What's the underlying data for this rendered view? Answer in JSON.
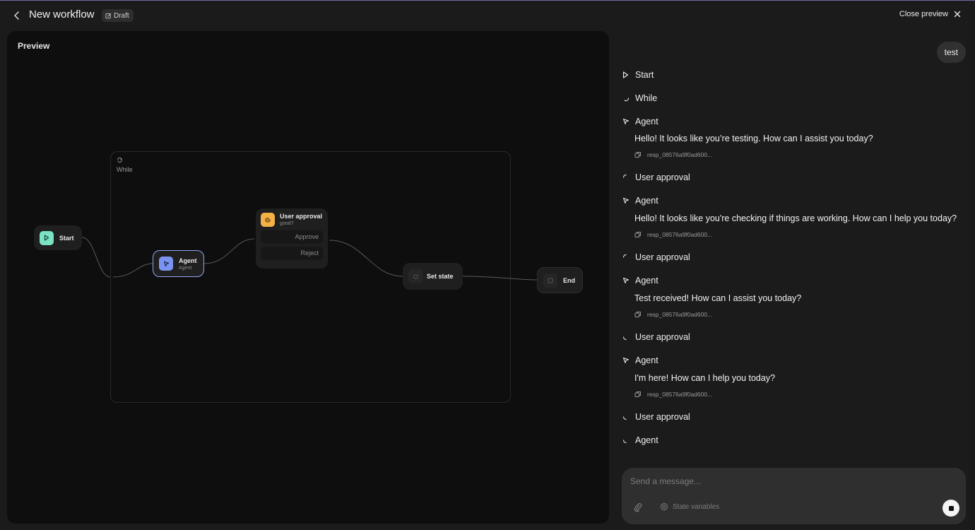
{
  "header": {
    "title": "New workflow",
    "badge": "Draft",
    "close_label": "Close preview"
  },
  "canvas": {
    "title": "Preview",
    "while_label": "While",
    "nodes": {
      "start": {
        "label": "Start"
      },
      "agent": {
        "label": "Agent",
        "sub": "Agent"
      },
      "approval": {
        "label": "User approval",
        "sub": "good?",
        "approve": "Approve",
        "reject": "Reject"
      },
      "setstate": {
        "label": "Set state"
      },
      "end": {
        "label": "End"
      }
    },
    "colors": {
      "start": "#7be3c4",
      "agent": "#7b93f0",
      "approval": "#f3b146",
      "agent_border": "#90a6f5"
    }
  },
  "chat": {
    "user_message": "test",
    "steps": [
      {
        "icon": "play-icon",
        "label": "Start"
      },
      {
        "icon": "spinner-icon",
        "label": "While"
      },
      {
        "icon": "agent-icon",
        "label": "Agent",
        "message": "Hello! It looks like you’re testing. How can I assist you today?",
        "response_id": "resp_08576a9f0ad600..."
      },
      {
        "icon": "spinner-icon",
        "label": "User approval"
      },
      {
        "icon": "agent-icon",
        "label": "Agent",
        "message": "Hello! It looks like you're checking if things are working. How can I help you today?",
        "response_id": "resp_08576a9f0ad600..."
      },
      {
        "icon": "spinner-icon",
        "label": "User approval"
      },
      {
        "icon": "agent-icon",
        "label": "Agent",
        "message": "Test received! How can I assist you today?",
        "response_id": "resp_08576a9f0ad600..."
      },
      {
        "icon": "spinner-icon",
        "label": "User approval"
      },
      {
        "icon": "agent-icon",
        "label": "Agent",
        "message": "I'm here! How can I help you today?",
        "response_id": "resp_08576a9f0ad600..."
      },
      {
        "icon": "spinner-icon",
        "label": "User approval"
      },
      {
        "icon": "spinner-icon",
        "label": "Agent"
      }
    ]
  },
  "composer": {
    "placeholder": "Send a message...",
    "state_variables": "State variables"
  }
}
